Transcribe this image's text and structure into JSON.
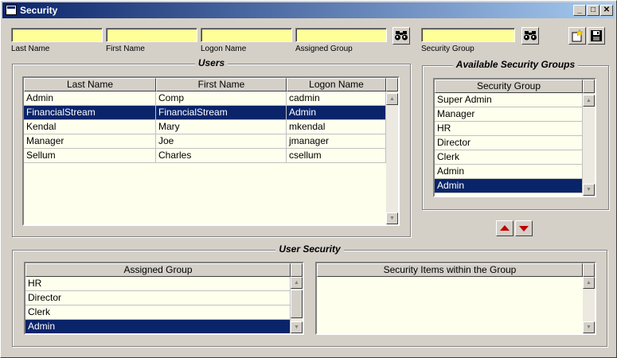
{
  "window": {
    "title": "Security",
    "minimize_glyph": "_",
    "maximize_glyph": "□",
    "close_glyph": "✕"
  },
  "filters": {
    "last_name": {
      "label": "Last Name",
      "value": ""
    },
    "first_name": {
      "label": "First Name",
      "value": ""
    },
    "logon_name": {
      "label": "Logon Name",
      "value": ""
    },
    "assigned_group": {
      "label": "Assigned Group",
      "value": ""
    },
    "security_group": {
      "label": "Security Group",
      "value": ""
    }
  },
  "icons": {
    "search": "binoculars-icon",
    "new": "new-document-icon",
    "save": "floppy-save-icon",
    "move_up": "red-up-arrow-icon",
    "move_down": "red-down-arrow-icon"
  },
  "users": {
    "title": "Users",
    "columns": [
      "Last Name",
      "First Name",
      "Logon Name"
    ],
    "rows": [
      {
        "last": "Admin",
        "first": "Comp",
        "logon": "cadmin",
        "selected": false
      },
      {
        "last": "FinancialStream",
        "first": "FinancialStream",
        "logon": "Admin",
        "selected": true
      },
      {
        "last": "Kendal",
        "first": "Mary",
        "logon": "mkendal",
        "selected": false
      },
      {
        "last": "Manager",
        "first": "Joe",
        "logon": "jmanager",
        "selected": false
      },
      {
        "last": "Sellum",
        "first": "Charles",
        "logon": "csellum",
        "selected": false
      }
    ]
  },
  "available_groups": {
    "title": "Available Security Groups",
    "column": "Security Group",
    "rows": [
      {
        "name": "Super Admin",
        "selected": false
      },
      {
        "name": "Manager",
        "selected": false
      },
      {
        "name": "HR",
        "selected": false
      },
      {
        "name": "Director",
        "selected": false
      },
      {
        "name": "Clerk",
        "selected": false
      },
      {
        "name": "Admin",
        "selected": false
      },
      {
        "name": "Admin",
        "selected": true
      }
    ]
  },
  "user_security": {
    "title": "User Security",
    "assigned_column": "Assigned Group",
    "assigned_rows": [
      {
        "name": "HR",
        "selected": false
      },
      {
        "name": "Director",
        "selected": false
      },
      {
        "name": "Clerk",
        "selected": false
      },
      {
        "name": "Admin",
        "selected": true
      }
    ],
    "items_column": "Security Items within the Group"
  },
  "colors": {
    "selection": "#0a246a",
    "input_bg": "#ffff99",
    "grid_bg": "#ffffee",
    "arrow": "#c00000"
  }
}
